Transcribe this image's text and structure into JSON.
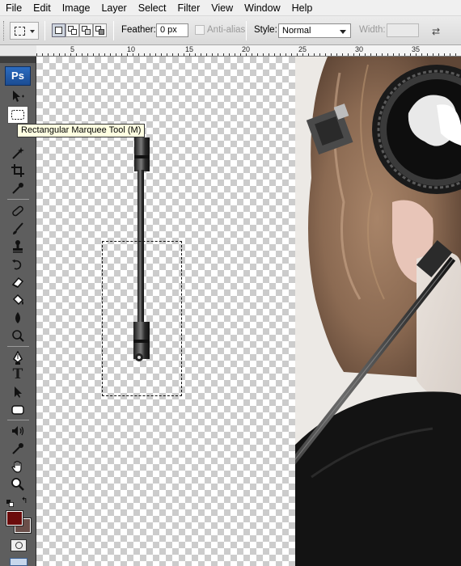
{
  "menu": [
    "File",
    "Edit",
    "Image",
    "Layer",
    "Select",
    "Filter",
    "View",
    "Window",
    "Help"
  ],
  "options": {
    "feather_label": "Feather:",
    "feather_value": "0 px",
    "antialias_label": "Anti-alias",
    "style_label": "Style:",
    "style_value": "Normal",
    "width_label": "Width:"
  },
  "ruler": {
    "labels": [
      "5",
      "10",
      "15",
      "20",
      "25",
      "30",
      "35"
    ]
  },
  "toolbox": {
    "logo": "Ps",
    "active_tool": "Rectangular Marquee Tool",
    "foreground_color": "#6b0c0c",
    "background_color": "#6a4e49"
  },
  "tooltip": "Rectangular Marquee Tool (M)",
  "icons": [
    "move-icon",
    "marquee-icon",
    "lasso-icon",
    "magic-wand-icon",
    "crop-icon",
    "eyedropper-icon",
    "healing-icon",
    "brush-icon",
    "stamp-icon",
    "history-brush-icon",
    "eraser-icon",
    "paint-bucket-icon",
    "blur-icon",
    "dodge-icon",
    "pen-icon",
    "type-icon",
    "path-select-icon",
    "shape-icon",
    "notes-icon",
    "eyedropper2-icon",
    "hand-icon",
    "zoom-icon"
  ]
}
